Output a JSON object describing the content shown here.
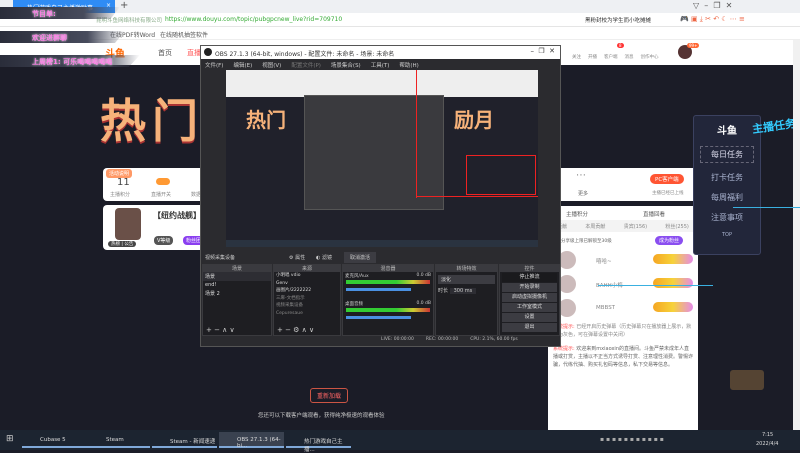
{
  "browser": {
    "tab_title": "热门游戏自己主播激励事",
    "url": "https://www.douyu.com/topic/pubgpcnew_live?rid=709710",
    "url_prefix": "昆明斗鱼网络科技有限公司",
    "search_text": "黑粉封校为学生而小吃摊摊",
    "bookmarks": [
      "在线PDF转Word",
      "在线随机抽签软件"
    ]
  },
  "overlays": [
    "节目单:",
    "欢迎进群聊",
    "上周榜1: 可乐喝喝喝喝喝"
  ],
  "douyu": {
    "nav": [
      {
        "label": "首页"
      },
      {
        "label": "直播"
      }
    ],
    "header_icons": [
      "关注",
      "开播",
      "客户端",
      "消息",
      "创作中心"
    ],
    "msg_count": "8",
    "avatar_badge": "99+",
    "banner": "热门游戏主播激励月",
    "banner_right": "励月",
    "stats": {
      "tag": "活动说明",
      "value": "11",
      "label1": "主播积分",
      "label2": "直播开关",
      "label3": "数据统计",
      "more": "更多"
    },
    "streamer": {
      "title": "【纽约战舰】白",
      "name": "热榜 | 公告",
      "tag1": "V等级",
      "tag2": "粉丝团"
    },
    "pc_client": "PC客户端",
    "pc_sub": "主播已经已上线",
    "chat": {
      "links": [
        "主播积分",
        "直播回看"
      ],
      "tabs": [
        "贡献",
        "本周贡献",
        "贵宾(156)",
        "粉丝(255)"
      ],
      "notice": "粉丝分享级上限已解锁至30级",
      "join_btn": "成为粉丝",
      "users": [
        {
          "name": "嘻哈~"
        },
        {
          "name": "BAHH小梅"
        },
        {
          "name": "MBBST"
        }
      ],
      "sys1_label": "系统提示:",
      "sys1": "已经开启历史弹幕（历史弹幕只在播放器上展示，默认为灰色，可在弹幕设置中关闭）",
      "sys2_label": "系统提示:",
      "sys2": "欢迎来到mxiaoxin的直播间。斗鱼严禁未成年人直播或打赏，主播以不正当方式诱导打赏、注意理性消费。警惕诈骗，代练代抽、购买礼包码等信息，私下交易等信息。"
    },
    "tasks": {
      "items": [
        "每日任务",
        "打卡任务",
        "每周福利",
        "注意事项"
      ],
      "top": "TOP",
      "badge": "主播任务"
    },
    "bottom_btn": "重新加载",
    "bottom_hint": "您还可以下载客户端观看，获得纯净极速的观看体验"
  },
  "obs": {
    "title": "OBS 27.1.3 (64-bit, windows) - 配置文件: 未命名 - 场景: 未命名",
    "menu": [
      "文件(F)",
      "编辑(E)",
      "视图(V)",
      "配置文件(P)",
      "场景集合(S)",
      "工具(T)",
      "帮助(H)"
    ],
    "source_toolbar": {
      "device": "视频采集设备",
      "props": "属性",
      "filters": "滤镜",
      "deactivate": "取消激活"
    },
    "docks": {
      "scenes": "场景",
      "sources": "来源",
      "mixer": "混音器",
      "transitions": "转场特效",
      "controls": "控件"
    },
    "scenes": [
      "场景",
      "end!",
      "场景 2"
    ],
    "sources": [
      "小明唱 vdio",
      "Genv",
      "画图片/2222222",
      "三麻-文档指示",
      "视频采集设备",
      "Cepuresaue"
    ],
    "mixer": [
      {
        "name": "麦克风/Aux",
        "db": "0.0 dB"
      },
      {
        "name": "桌面音频",
        "db": "0.0 dB"
      }
    ],
    "transition": {
      "type": "淡化",
      "duration_label": "时长",
      "duration": "300 ms"
    },
    "controls": [
      "停止推流",
      "开始录制",
      "启动虚拟摄像机",
      "工作室模式",
      "设置",
      "退出"
    ],
    "status": {
      "live": "LIVE: 00:00:00",
      "rec": "REC: 00:00:00",
      "cpu": "CPU: 2.1%, 60.00 fps"
    }
  },
  "taskbar": {
    "items": [
      "Cubase 5",
      "Steam",
      "Steam - 新闻速递",
      "OBS 27.1.3 (64-bi...",
      "热门游戏自己主播..."
    ],
    "time": "7:15",
    "date": "2022/4/4"
  }
}
